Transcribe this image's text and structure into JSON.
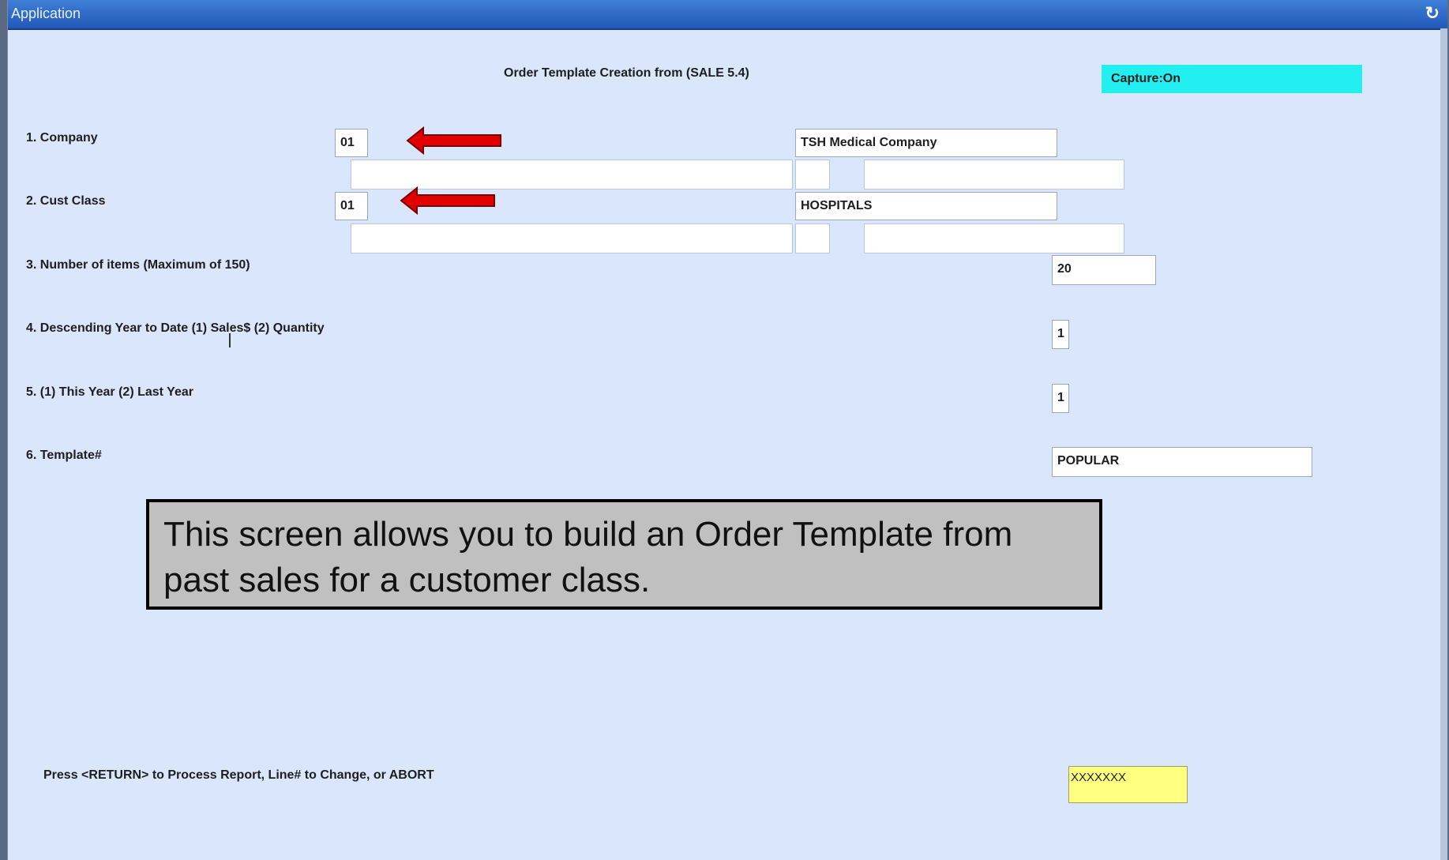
{
  "window": {
    "title": "Application"
  },
  "heading": "Order Template Creation from (SALE 5.4)",
  "capture": "Capture:On",
  "rows": [
    {
      "label": "1. Company",
      "code": "01",
      "description": "TSH Medical Company"
    },
    {
      "label": "2. Cust Class",
      "code": "01",
      "description": "HOSPITALS"
    },
    {
      "label": "3. Number of items (Maximum of 150)",
      "value": "20"
    },
    {
      "label": "4. Descending Year to Date (1) Sales$ (2) Quantity",
      "value": "1"
    },
    {
      "label": "5. (1) This Year  (2) Last Year",
      "value": "1"
    },
    {
      "label": "6. Template#",
      "value": "POPULAR"
    }
  ],
  "callout": "This screen allows you to build an Order Template from past sales for a customer class.",
  "prompt": "Press <RETURN> to Process Report, Line# to Change, or ABORT",
  "command_input": "XXXXXXX",
  "colors": {
    "arrow": "#e00000",
    "capture_bg": "#22f0f0",
    "command_bg": "#ffff80",
    "window_bg": "#d9e6fb"
  }
}
